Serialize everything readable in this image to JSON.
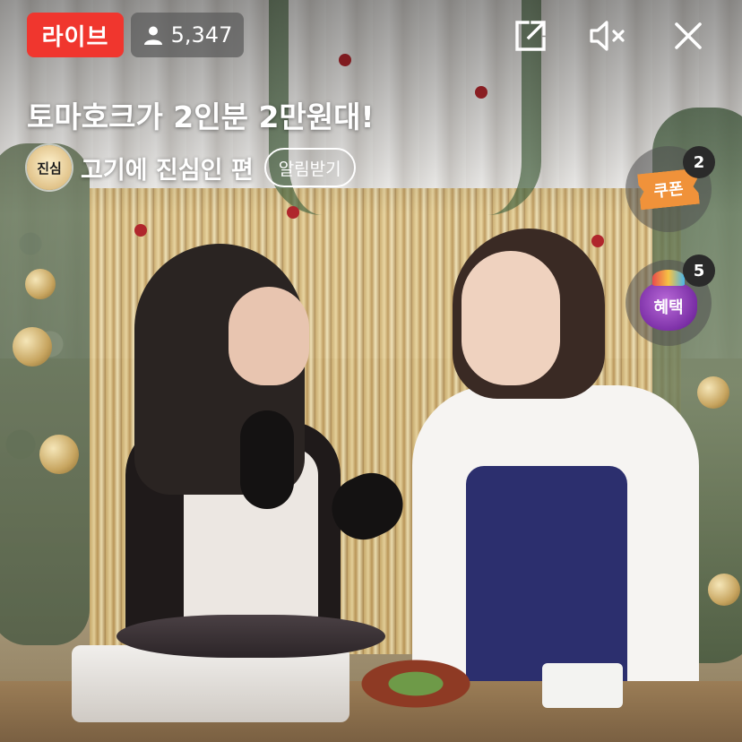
{
  "header": {
    "live_label": "라이브",
    "viewer_count": "5,347"
  },
  "stream": {
    "title": "토마호크가 2인분 2만원대!",
    "channel_name": "고기에 진심인 편",
    "channel_avatar_text": "진심",
    "follow_label": "알림받기"
  },
  "side_actions": {
    "coupon": {
      "label": "쿠폰",
      "count": "2"
    },
    "benefit": {
      "label": "혜택",
      "count": "5"
    }
  },
  "icons": {
    "viewers": "person-icon",
    "share": "share-icon",
    "mute": "mute-icon",
    "close": "close-icon"
  },
  "colors": {
    "live_badge": "#f0362e",
    "coupon": "#f0923a",
    "benefit": "#7b2fa6"
  }
}
